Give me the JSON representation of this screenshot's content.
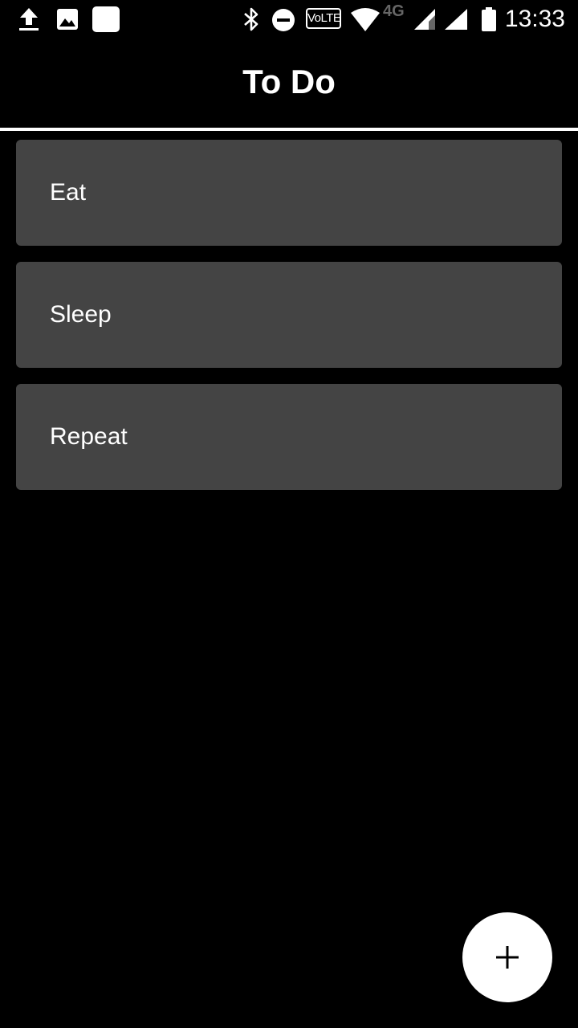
{
  "status_bar": {
    "time": "13:33",
    "network_label": "4G",
    "volte_label": "VoLTE",
    "icons": [
      "upload-icon",
      "image-icon",
      "app-notification-icon",
      "bluetooth-icon",
      "do-not-disturb-icon",
      "volte-icon",
      "wifi-icon",
      "signal-icon",
      "signal-icon",
      "battery-icon"
    ]
  },
  "app_bar": {
    "title": "To Do"
  },
  "todos": [
    {
      "label": "Eat"
    },
    {
      "label": "Sleep"
    },
    {
      "label": "Repeat"
    }
  ],
  "fab": {
    "icon": "plus-icon"
  },
  "colors": {
    "background": "#000000",
    "card": "#444444",
    "text": "#ffffff",
    "fab": "#ffffff",
    "fab_icon": "#000000"
  }
}
